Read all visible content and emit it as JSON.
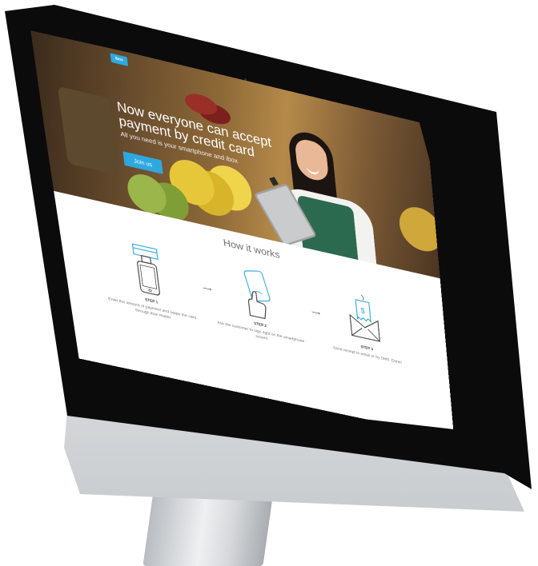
{
  "brand": {
    "logo_text": "ibox"
  },
  "hero": {
    "title": "Now everyone can accept payment by credit card",
    "subtitle": "All you need is your smartphone and ibox",
    "cta_label": "Join us"
  },
  "how_it_works": {
    "title": "How it works",
    "steps": [
      {
        "label": "STEP 1",
        "description": "Enter the amount of payment and swipe the card through ibox reader",
        "icon": "phone-card-reader-icon"
      },
      {
        "label": "STEP 2",
        "description": "Ask the customer to sign right on the smartphone screen",
        "icon": "hand-sign-phone-icon"
      },
      {
        "label": "STEP 3",
        "description": "Send receipt to email or by SMS. Done!",
        "icon": "email-receipt-icon"
      }
    ]
  },
  "colors": {
    "accent": "#2ea8e0",
    "icon_line": "#444444"
  }
}
